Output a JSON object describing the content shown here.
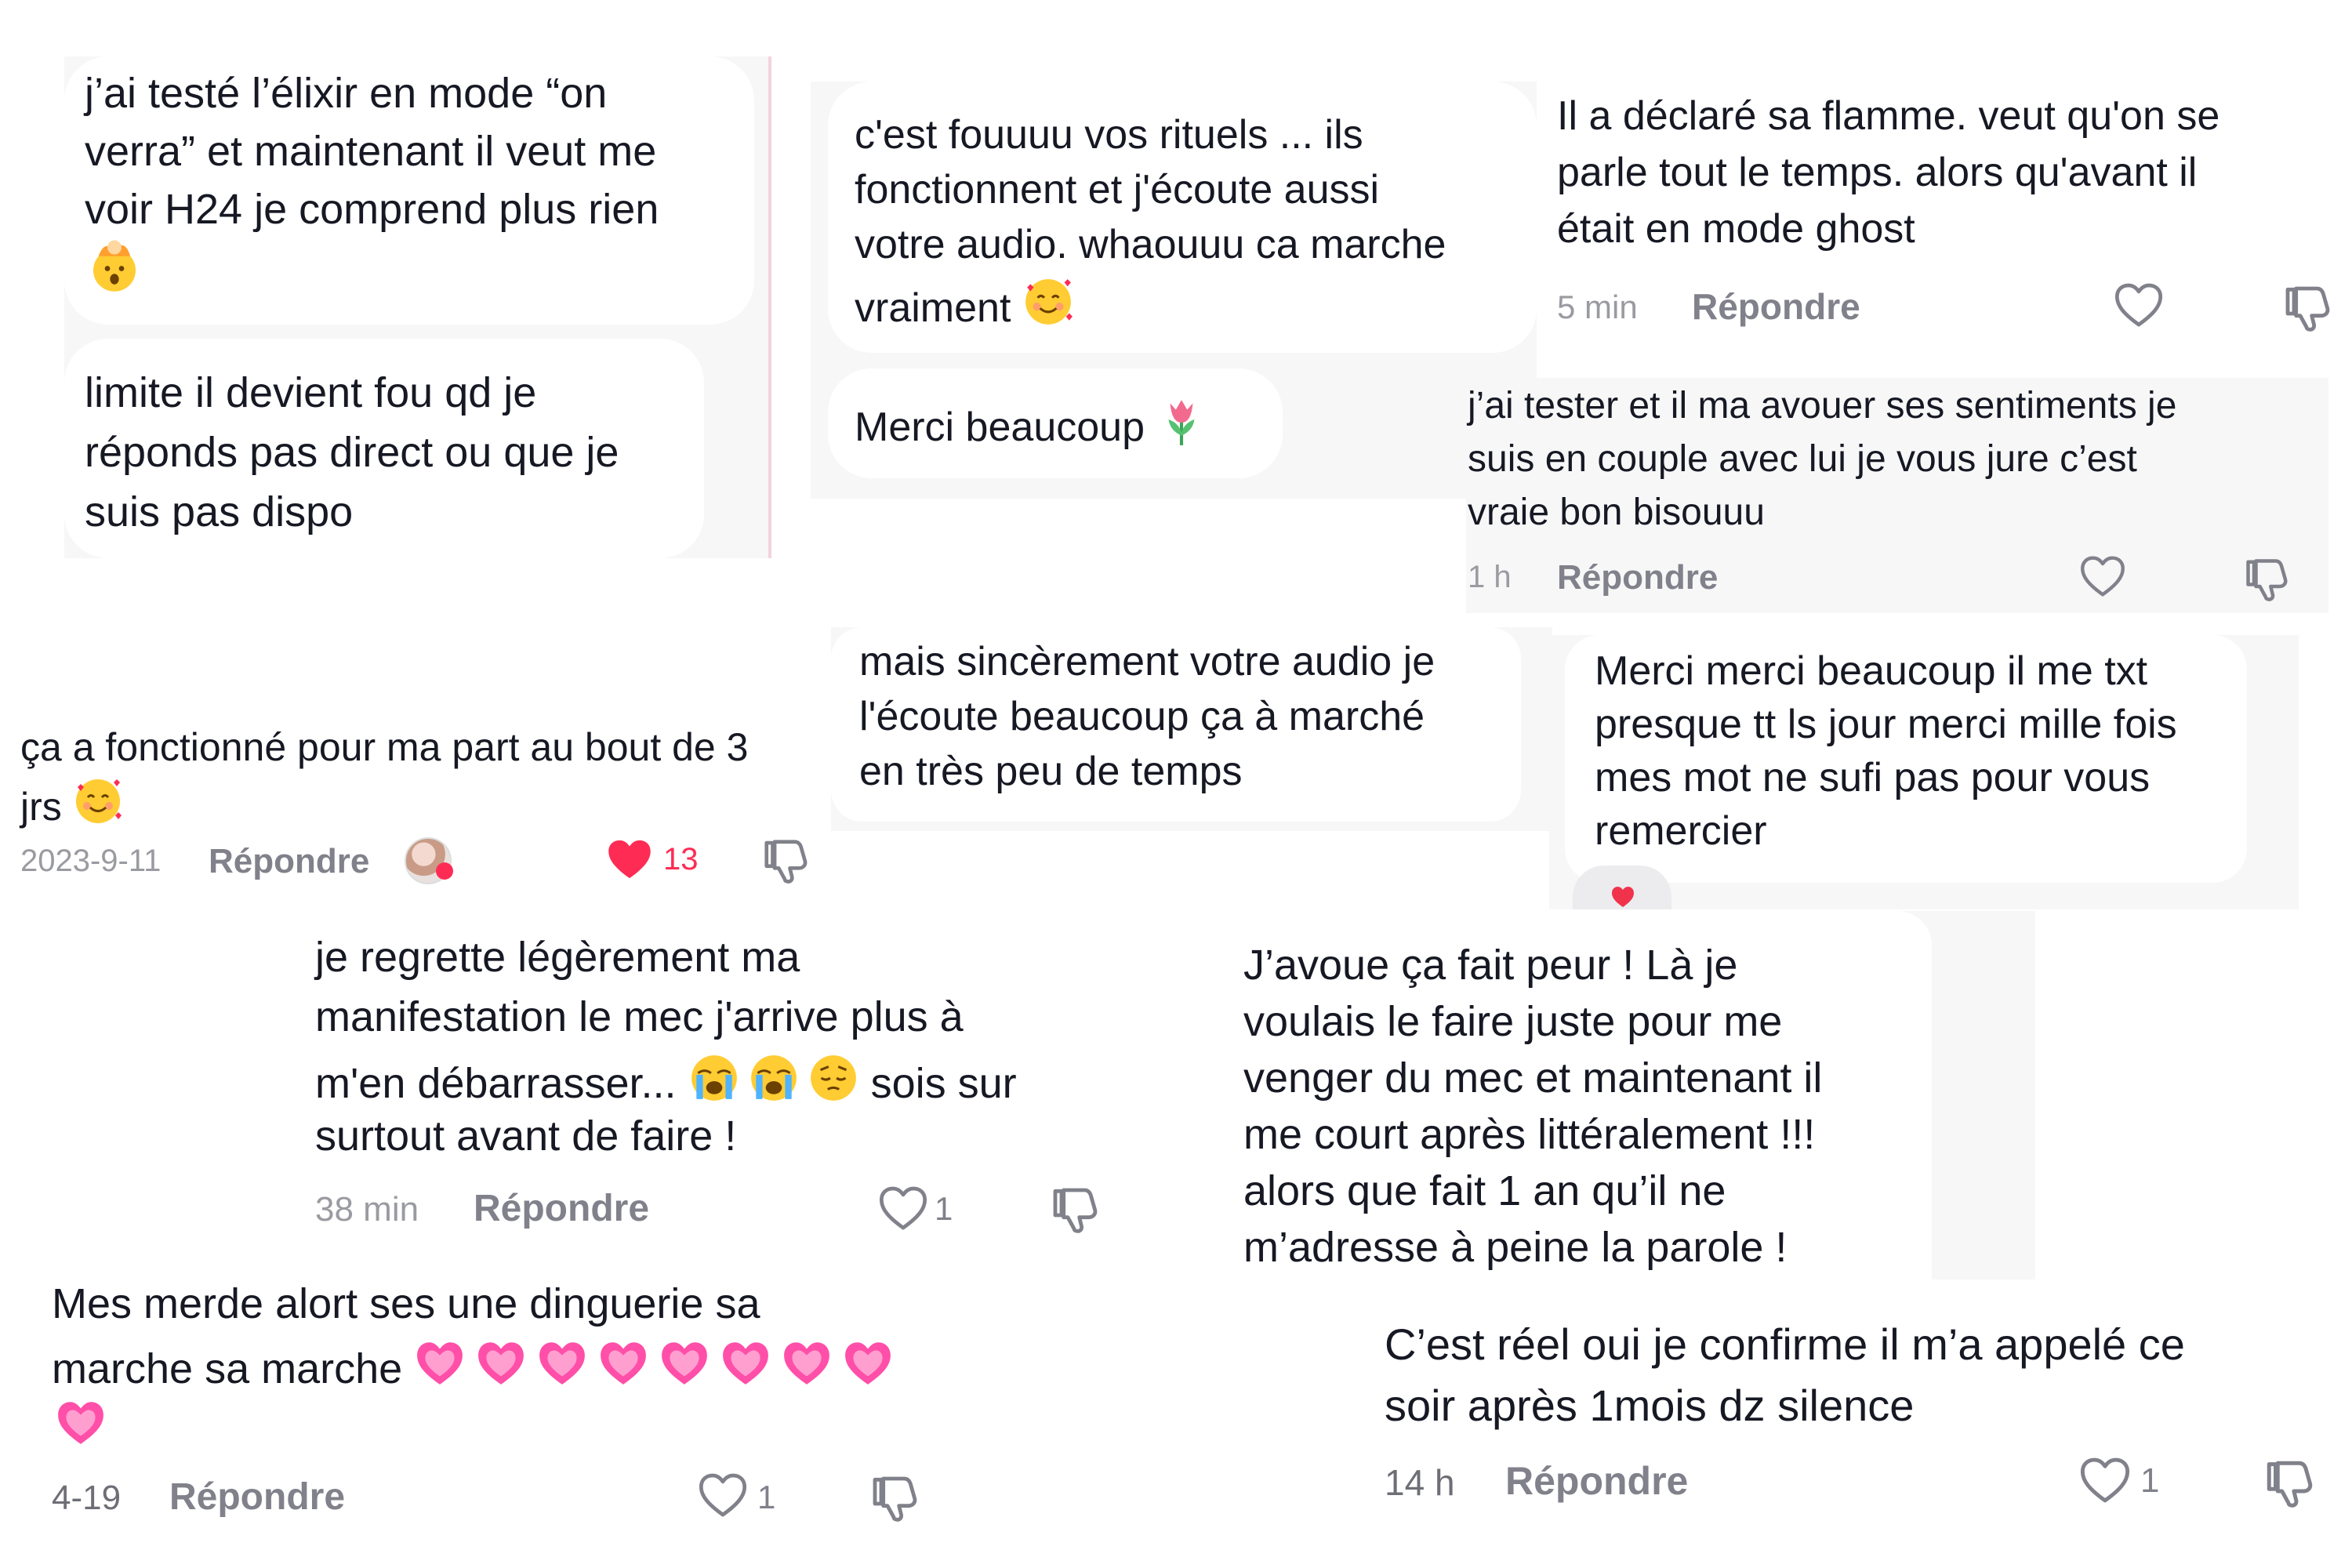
{
  "comments": [
    {
      "id": "c1",
      "lines": [
        "j’ai testé l’élixir en mode “on",
        "verra” et maintenant il veut me",
        "voir H24 je comprend plus rien"
      ],
      "emoji_line": "exploding-head-emoji"
    },
    {
      "id": "c2",
      "lines": [
        "limite il devient fou qd je",
        "réponds pas direct ou que je",
        "suis pas dispo"
      ]
    },
    {
      "id": "c3",
      "lines": [
        "c'est fouuuu vos rituels ... ils",
        "fonctionnent et j'écoute aussi",
        "votre audio. whaouuu ca marche",
        "vraiment"
      ],
      "emoji": "smiling-face-with-hearts-emoji"
    },
    {
      "id": "c4",
      "lines": [
        "Merci beaucoup"
      ],
      "emoji": "tulip-emoji"
    },
    {
      "id": "c5",
      "lines": [
        "Il a déclaré sa flamme. veut qu'on se",
        "parle tout le temps. alors qu'avant il",
        "était en mode ghost"
      ],
      "time": "5 min",
      "reply": "Répondre"
    },
    {
      "id": "c6",
      "lines": [
        "j’ai tester et il ma avouer ses sentiments je",
        "suis en couple avec lui je vous jure c’est",
        "vraie bon bisouuu"
      ],
      "time": "1 h",
      "reply": "Répondre"
    },
    {
      "id": "c7",
      "lines": [
        "ça a fonctionné pour ma part au bout de 3",
        "jrs"
      ],
      "emoji": "smiling-face-with-hearts-emoji",
      "time": "2023-9-11",
      "reply": "Répondre",
      "likes": "13"
    },
    {
      "id": "c8",
      "lines": [
        "mais sincèrement votre audio je",
        "l'écoute beaucoup ça à marché",
        "en très peu de temps"
      ]
    },
    {
      "id": "c9",
      "lines": [
        "Merci merci beaucoup il me txt",
        "presque tt ls jour merci mille fois",
        "mes mot ne sufi pas pour vous",
        "remercier"
      ]
    },
    {
      "id": "c10",
      "lines": [
        "je regrette légèrement ma",
        "manifestation le mec j'arrive plus à",
        "m'en débarrasser...",
        "surtout avant de faire !"
      ],
      "line3_tail": "sois sur",
      "emojis": [
        "loudly-crying-face-emoji",
        "loudly-crying-face-emoji",
        "pensive-face-emoji"
      ],
      "time": "38 min",
      "reply": "Répondre",
      "likes": "1"
    },
    {
      "id": "c11",
      "lines": [
        "J’avoue ça fait peur ! Là je",
        "voulais le faire juste pour me",
        "venger du mec et maintenant il",
        "me court après littéralement !!!",
        "alors que fait 1 an qu’il ne",
        "m’adresse à peine la parole !"
      ]
    },
    {
      "id": "c12",
      "lines": [
        "Mes merde alort ses une dinguerie sa",
        "marche sa marche"
      ],
      "emoji_count": 9,
      "emoji": "growing-heart-emoji",
      "time": "4-19",
      "reply": "Répondre",
      "likes": "1"
    },
    {
      "id": "c13",
      "lines": [
        "C’est réel oui je confirme il m’a appelé ce",
        "soir après 1mois dz silence"
      ],
      "time": "14 h",
      "reply": "Répondre",
      "likes": "1"
    }
  ],
  "colors": {
    "text": "#161823",
    "meta": "#9a9ba1",
    "reply": "#80818a",
    "like_active": "#fe2c55",
    "panel_bg": "#f7f7f8"
  }
}
